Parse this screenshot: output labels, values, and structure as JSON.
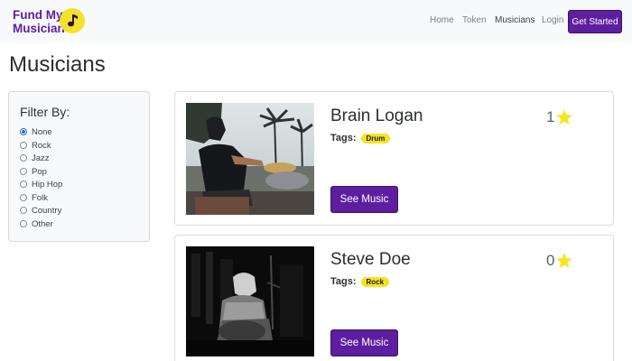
{
  "navbar": {
    "brand": "Fund My Musician",
    "links": [
      "Home",
      "Token",
      "Musicians",
      "Login"
    ],
    "cta": "Get Started"
  },
  "page": {
    "title": "Musicians"
  },
  "filter": {
    "title": "Filter By:",
    "selected": "None",
    "options": [
      "None",
      "Rock",
      "Jazz",
      "Pop",
      "Hip Hop",
      "Folk",
      "Country",
      "Other"
    ]
  },
  "musicians": [
    {
      "name": "Brain Logan",
      "tags_label": "Tags:",
      "tag": "Drum",
      "rating": "1",
      "button": "See Music"
    },
    {
      "name": "Steve Doe",
      "tags_label": "Tags:",
      "tag": "Rock",
      "rating": "0",
      "button": "See Music"
    }
  ],
  "colors": {
    "brand_purple": "#5d1ea0",
    "brand_yellow": "#f4e228",
    "tag_yellow": "#f6e41f",
    "star_yellow": "#f5e61c"
  }
}
